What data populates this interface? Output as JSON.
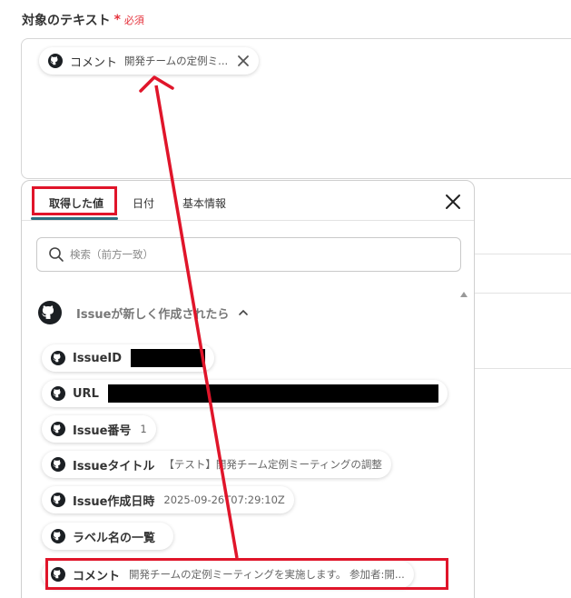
{
  "field": {
    "label": "対象のテキスト",
    "required_mark": "*",
    "required_text": "必須"
  },
  "selected_chip": {
    "name": "コメント",
    "value": "開発チームの定例ミ..."
  },
  "panel": {
    "tabs": [
      "取得した値",
      "日付",
      "基本情報"
    ],
    "active_tab": 0,
    "search_placeholder": "検索（前方一致）",
    "section_title": "Issueが新しく作成されたら",
    "items": [
      {
        "name": "IssueID",
        "value": "",
        "redacted": true
      },
      {
        "name": "URL",
        "value": "",
        "redacted": true
      },
      {
        "name": "Issue番号",
        "value": "1"
      },
      {
        "name": "Issueタイトル",
        "value": "【テスト】開発チーム定例ミーティングの調整"
      },
      {
        "name": "Issue作成日時",
        "value": "2025-09-26T07:29:10Z"
      },
      {
        "name": "ラベル名の一覧",
        "value": ""
      },
      {
        "name": "コメント",
        "value": "開発チームの定例ミーティングを実施します。 参加者:開..."
      }
    ]
  },
  "colors": {
    "highlight": "#e0152a",
    "tab_underline": "#2c6f80",
    "required": "#e5323c"
  },
  "icons": [
    "github-icon",
    "close-icon",
    "search-icon",
    "chevron-up-icon",
    "scroll-up-icon"
  ]
}
